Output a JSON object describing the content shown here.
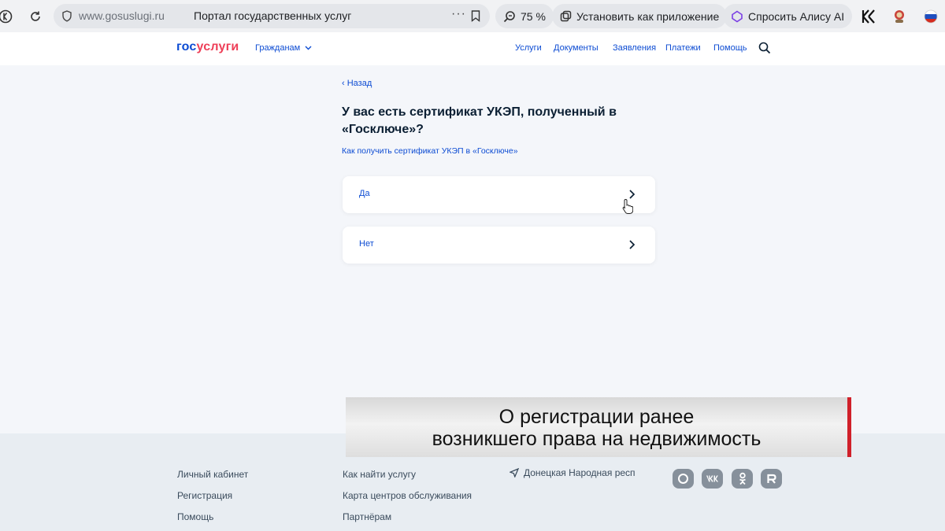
{
  "browser": {
    "url": "www.gosuslugi.ru",
    "tab_title": "Портал государственных услуг",
    "more": "···",
    "zoom": "75 %",
    "install_app": "Установить как приложение",
    "ask_alice": "Спросить Алису AI"
  },
  "header": {
    "logo_part1": "гос",
    "logo_part2": "услуги",
    "audience": "Гражданам",
    "nav": [
      "Услуги",
      "Документы",
      "Заявления",
      "Платежи",
      "Помощь"
    ]
  },
  "main": {
    "back": "Назад",
    "question": "У вас есть сертификат УКЭП, полученный в «Госключе»?",
    "help_link": "Как получить сертификат УКЭП в «Госключе»",
    "options": [
      "Да",
      "Нет"
    ]
  },
  "footer": {
    "col1": [
      "Личный кабинет",
      "Регистрация",
      "Помощь"
    ],
    "col2": [
      "Как найти услугу",
      "Карта центров обслуживания",
      "Партнёрам"
    ],
    "location": "Донецкая Народная респ",
    "social_icons": [
      "max-icon",
      "vk-icon",
      "ok-icon",
      "rutube-icon"
    ]
  },
  "caption": {
    "line1": "О регистрации ранее",
    "line2": "возникшего права на недвижимость"
  },
  "colors": {
    "accent": "#0d4cd3",
    "logo_red": "#ee3f58",
    "caption_bar": "#d0202a"
  }
}
